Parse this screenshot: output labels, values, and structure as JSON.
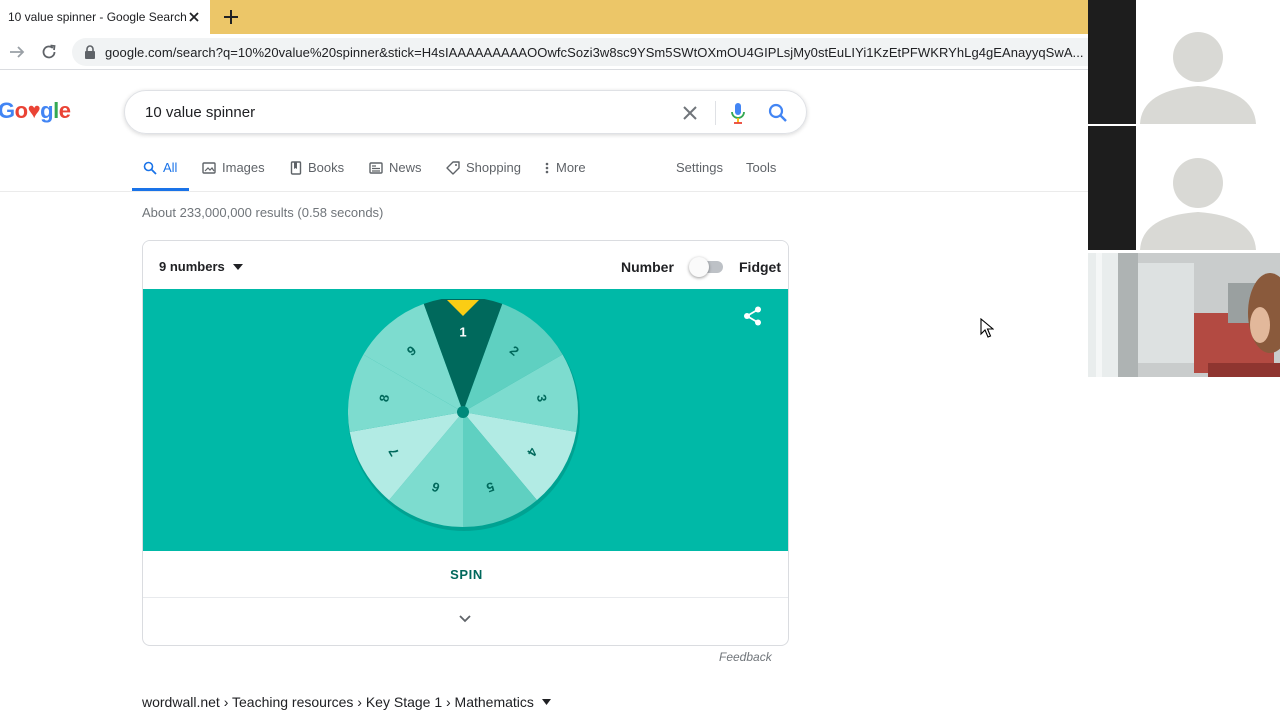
{
  "browser": {
    "tab_title": "10 value spinner - Google Search",
    "url": "google.com/search?q=10%20value%20spinner&stick=H4sIAAAAAAAAAOOwfcSozi3w8sc9YSm5SWtOXmOU4GIPLsjMy0stEuLIYi1KzEtPFWKRYhLg4gEAnayyqSwA..."
  },
  "google": {
    "logo_letters": [
      "G",
      "o",
      "♥",
      "g",
      "l",
      "e"
    ],
    "search_query": "10 value spinner",
    "tabs": [
      {
        "label": "All"
      },
      {
        "label": "Images"
      },
      {
        "label": "Books"
      },
      {
        "label": "News"
      },
      {
        "label": "Shopping"
      },
      {
        "label": "More"
      }
    ],
    "settings_label": "Settings",
    "tools_label": "Tools",
    "result_stats": "About 233,000,000 results (0.58 seconds)"
  },
  "spinner": {
    "mode_label": "9 numbers",
    "number_label": "Number",
    "fidget_label": "Fidget",
    "toggle_on": false,
    "spin_label": "SPIN",
    "feedback_label": "Feedback",
    "segments": [
      "1",
      "2",
      "3",
      "4",
      "5",
      "6",
      "7",
      "8",
      "9"
    ],
    "colors": {
      "stage": "#00b9a7",
      "selected": "#00695c",
      "light_a": "#7ddccf",
      "light_b": "#b2ebe4",
      "light_c": "#5fd0c1",
      "pointer": "#fbcd14"
    }
  },
  "result": {
    "breadcrumb": "wordwall.net › Teaching resources › Key Stage 1 › Mathematics"
  }
}
